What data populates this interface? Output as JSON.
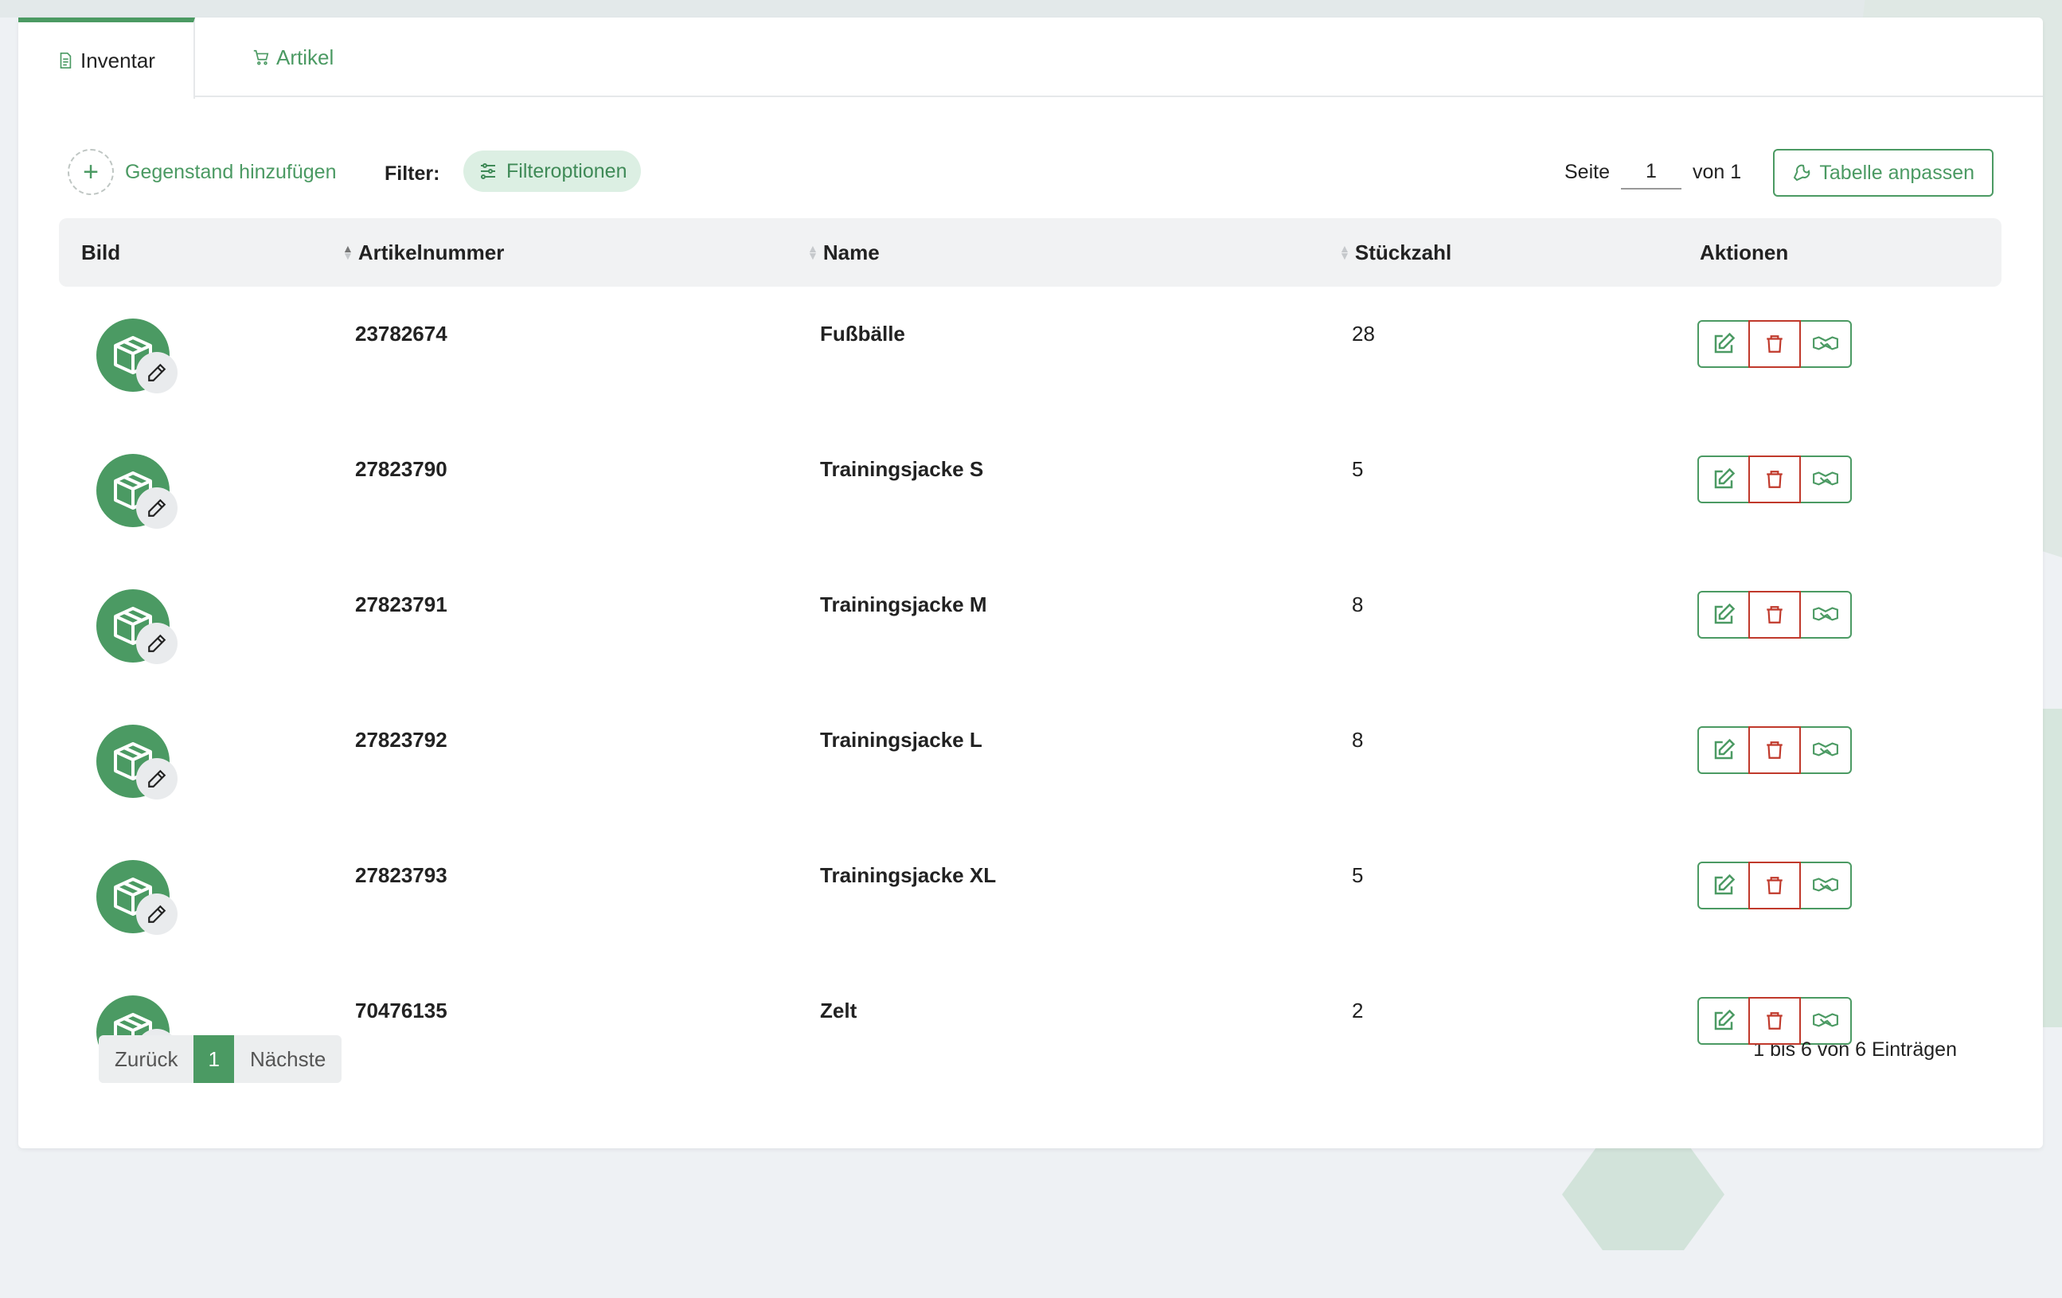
{
  "tabs": [
    {
      "label": "Inventar",
      "icon": "document-icon",
      "active": true
    },
    {
      "label": "Artikel",
      "icon": "cart-icon",
      "active": false
    }
  ],
  "toolbar": {
    "add_label": "Gegenstand hinzufügen",
    "filter_label": "Filter:",
    "filter_options_label": "Filteroptionen",
    "page_label": "Seite",
    "page_value": "1",
    "page_of": "von 1",
    "customize_label": "Tabelle anpassen"
  },
  "table": {
    "columns": [
      "Bild",
      "Artikelnummer",
      "Name",
      "Stückzahl",
      "Aktionen"
    ],
    "rows": [
      {
        "number": "23782674",
        "name": "Fußbälle",
        "count": "28"
      },
      {
        "number": "27823790",
        "name": "Trainingsjacke S",
        "count": "5"
      },
      {
        "number": "27823791",
        "name": "Trainingsjacke M",
        "count": "8"
      },
      {
        "number": "27823792",
        "name": "Trainingsjacke L",
        "count": "8"
      },
      {
        "number": "27823793",
        "name": "Trainingsjacke XL",
        "count": "5"
      },
      {
        "number": "70476135",
        "name": "Zelt",
        "count": "2"
      }
    ]
  },
  "pagination": {
    "prev": "Zurück",
    "current": "1",
    "next": "Nächste",
    "summary": "1 bis 6 von 6 Einträgen"
  },
  "colors": {
    "accent": "#4b9a63",
    "danger": "#c0392b"
  }
}
